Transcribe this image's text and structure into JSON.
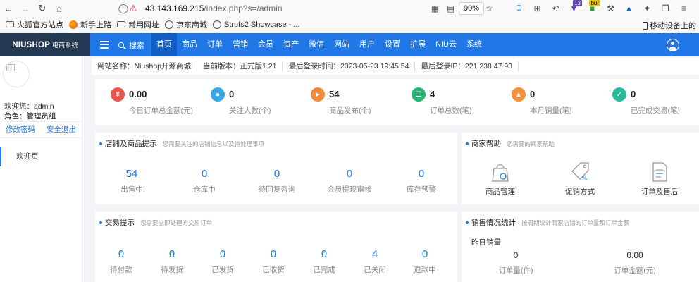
{
  "browser": {
    "url_host": "43.143.169.215",
    "url_path": "/index.php?s=/admin",
    "zoom": "90%",
    "badges": {
      "ext1": "13",
      "ext2": "bur"
    }
  },
  "bookmarks": {
    "items": [
      {
        "label": "火狐官方站点",
        "icon": "folder-icon"
      },
      {
        "label": "新手上路",
        "icon": "firefox-icon"
      },
      {
        "label": "常用网址",
        "icon": "folder-icon"
      },
      {
        "label": "京东商城",
        "icon": "globe-icon"
      },
      {
        "label": "Struts2 Showcase - ...",
        "icon": "globe-icon"
      }
    ],
    "mobile": "移动设备上的"
  },
  "header": {
    "logo": "NIUSHOP",
    "logo_sub": "电商系统",
    "search_label": "搜索",
    "nav": [
      "首页",
      "商品",
      "订单",
      "营销",
      "会员",
      "资产",
      "微信",
      "网站",
      "用户",
      "设置",
      "扩展",
      "NIU云",
      "系统"
    ],
    "active_index": 0
  },
  "sidebar": {
    "welcome": "欢迎您：admin",
    "role": "角色：管理员组",
    "change_password": "修改密码",
    "logout": "安全退出",
    "menu_item": "欢迎页"
  },
  "infobar": {
    "site_name": "网站名称：Niushop开源商城",
    "version": "当前版本：正式版1.21",
    "last_login_time": "最后登录时间：2023-05-23 19:45:54",
    "last_login_ip": "最后登录IP：221.238.47.93"
  },
  "stats": [
    {
      "value": "0.00",
      "label": "今日订单总金额(元)",
      "color": "#e8584f",
      "icon": "money-icon"
    },
    {
      "value": "0",
      "label": "关注人数(个)",
      "color": "#3aa7e8",
      "icon": "drop-icon"
    },
    {
      "value": "54",
      "label": "商品发布(个)",
      "color": "#f08a3c",
      "icon": "megaphone-icon"
    },
    {
      "value": "4",
      "label": "订单总数(笔)",
      "color": "#22b573",
      "icon": "clipboard-icon"
    },
    {
      "value": "0",
      "label": "本月销量(笔)",
      "color": "#f5903d",
      "icon": "chart-icon"
    },
    {
      "value": "0",
      "label": "已完成交易(笔)",
      "color": "#2ab99b",
      "icon": "check-icon"
    }
  ],
  "shop_panel": {
    "title": "店铺及商品提示",
    "subtitle": "您需要关注的店铺信息以及待处理事项",
    "items": [
      {
        "value": "54",
        "label": "出售中"
      },
      {
        "value": "0",
        "label": "仓库中"
      },
      {
        "value": "0",
        "label": "待回复咨询"
      },
      {
        "value": "0",
        "label": "会员提现审核"
      },
      {
        "value": "0",
        "label": "库存预警"
      }
    ]
  },
  "help_panel": {
    "title": "商家帮助",
    "subtitle": "您需要的商家帮助",
    "items": [
      {
        "label": "商品管理",
        "icon": "bag-icon"
      },
      {
        "label": "促销方式",
        "icon": "tag-icon"
      },
      {
        "label": "订单及售后",
        "icon": "document-icon"
      }
    ]
  },
  "trade_panel": {
    "title": "交易提示",
    "subtitle": "您需要立即处理的交易订单",
    "items": [
      {
        "value": "0",
        "label": "待付款"
      },
      {
        "value": "0",
        "label": "待发货"
      },
      {
        "value": "0",
        "label": "已发货"
      },
      {
        "value": "0",
        "label": "已收货"
      },
      {
        "value": "0",
        "label": "已完成"
      },
      {
        "value": "4",
        "label": "已关闭"
      },
      {
        "value": "0",
        "label": "退款中"
      }
    ]
  },
  "sales_panel": {
    "title": "销售情况统计",
    "subtitle": "按周期统计商家店铺的订单量和订单金额",
    "period": "昨日销量",
    "items": [
      {
        "value": "0",
        "label": "订单量(件)"
      },
      {
        "value": "0.00",
        "label": "订单金额(元)"
      }
    ]
  }
}
